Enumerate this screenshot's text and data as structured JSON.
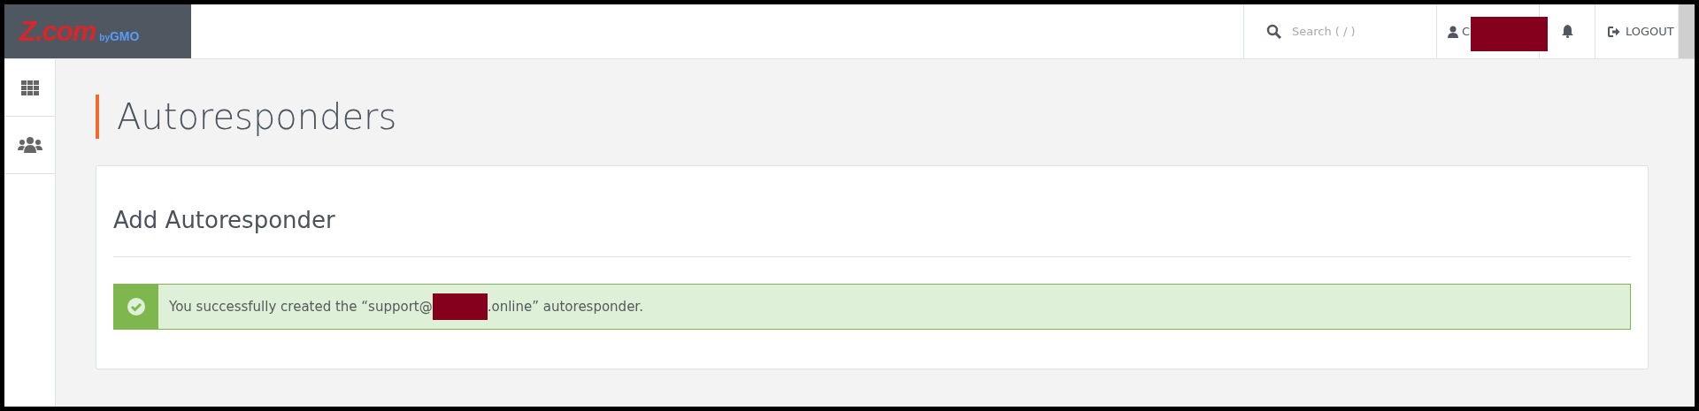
{
  "header": {
    "logo": {
      "brand": "Z.com",
      "suffix_small": "by",
      "suffix": "GMO"
    },
    "search": {
      "placeholder": "Search ( / )"
    },
    "user": {
      "label": "C",
      "redacted": true
    },
    "logout": "LOGOUT"
  },
  "sidebar": {
    "items": [
      {
        "kind": "grid",
        "selected": false
      },
      {
        "kind": "users",
        "selected": false
      }
    ]
  },
  "page": {
    "title": "Autoresponders"
  },
  "card": {
    "title": "Add Autoresponder",
    "alert": {
      "kind": "success",
      "text_before": "You successfully created the “support@",
      "redacted": true,
      "text_after": ".online” autoresponder."
    }
  }
}
